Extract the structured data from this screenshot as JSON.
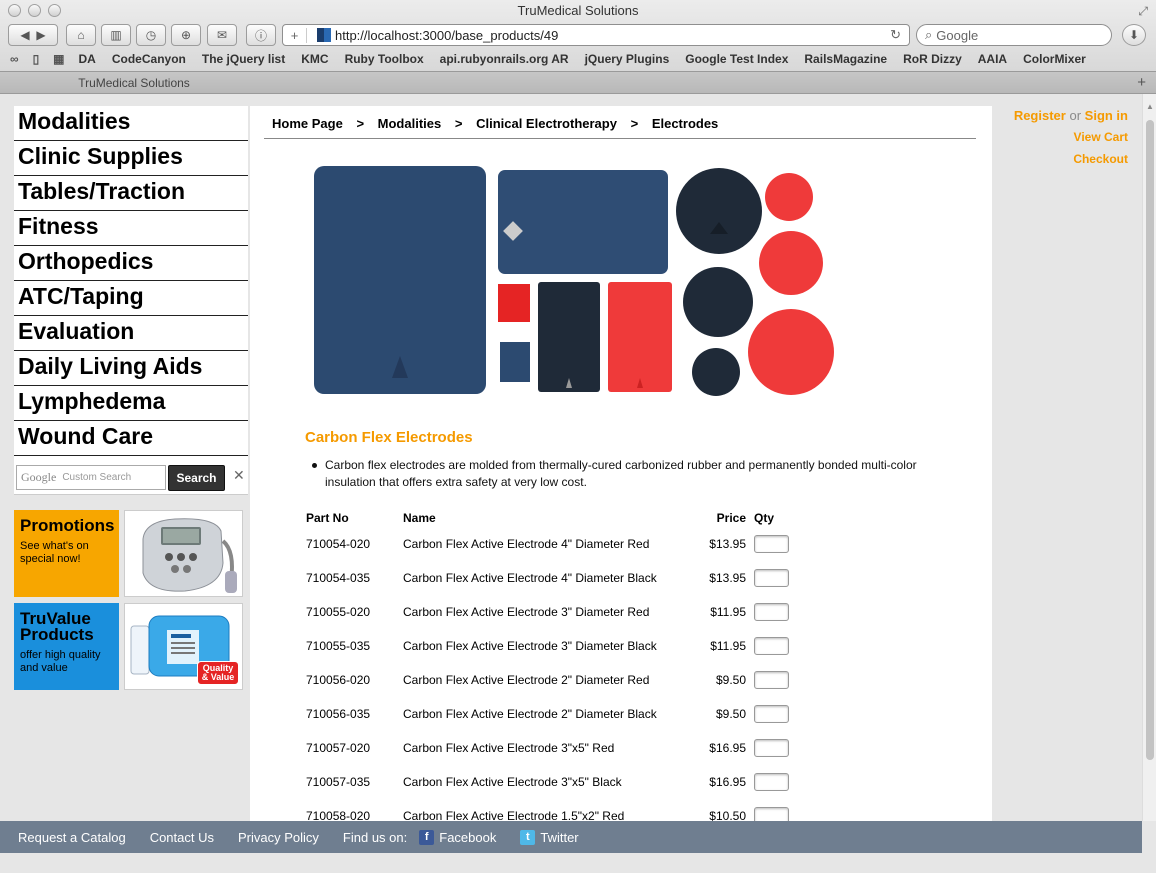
{
  "browser": {
    "title": "TruMedical Solutions",
    "url": "http://localhost:3000/base_products/49",
    "search_placeholder": "Google",
    "bookmarks": [
      "DA",
      "CodeCanyon",
      "The jQuery list",
      "KMC",
      "Ruby Toolbox",
      "api.rubyonrails.org AR",
      "jQuery Plugins",
      "Google Test Index",
      "RailsMagazine",
      "RoR Dizzy",
      "AAIA",
      "ColorMixer"
    ],
    "tab_label": "TruMedical Solutions"
  },
  "sidebar": {
    "nav": [
      "Modalities",
      "Clinic Supplies",
      "Tables/Traction",
      "Fitness",
      "Orthopedics",
      "ATC/Taping",
      "Evaluation",
      "Daily Living Aids",
      "Lymphedema",
      "Wound Care"
    ],
    "search_placeholder": "Custom Search",
    "search_button": "Search",
    "search_brand": "Google",
    "promos": [
      {
        "title": "Promotions",
        "sub": "See what's on special now!",
        "color": "#f7a600"
      },
      {
        "title": "TruValue Products",
        "sub": "offer high quality and value",
        "color": "#1a8fdc",
        "badge": "Quality & Value"
      }
    ]
  },
  "breadcrumb": [
    "Home Page",
    ">",
    "Modalities",
    ">",
    "Clinical Electrotherapy",
    ">",
    "Electrodes"
  ],
  "product": {
    "title": "Carbon Flex Electrodes",
    "description": "Carbon flex electrodes are molded from thermally-cured carbonized rubber and permanently bonded multi-color insulation that offers extra safety at very low cost.",
    "columns": {
      "part": "Part No",
      "name": "Name",
      "price": "Price",
      "qty": "Qty"
    },
    "rows": [
      {
        "part": "710054-020",
        "name": "Carbon Flex Active Electrode 4\" Diameter Red",
        "price": "$13.95"
      },
      {
        "part": "710054-035",
        "name": "Carbon Flex Active Electrode 4\" Diameter Black",
        "price": "$13.95"
      },
      {
        "part": "710055-020",
        "name": "Carbon Flex Active Electrode 3\" Diameter Red",
        "price": "$11.95"
      },
      {
        "part": "710055-035",
        "name": "Carbon Flex Active Electrode 3\" Diameter Black",
        "price": "$11.95"
      },
      {
        "part": "710056-020",
        "name": "Carbon Flex Active Electrode 2\" Diameter Red",
        "price": "$9.50"
      },
      {
        "part": "710056-035",
        "name": "Carbon Flex Active Electrode 2\" Diameter Black",
        "price": "$9.50"
      },
      {
        "part": "710057-020",
        "name": "Carbon Flex Active Electrode 3\"x5\" Red",
        "price": "$16.95"
      },
      {
        "part": "710057-035",
        "name": "Carbon Flex Active Electrode 3\"x5\" Black",
        "price": "$16.95"
      },
      {
        "part": "710058-020",
        "name": "Carbon Flex Active Electrode 1.5\"x2\" Red",
        "price": "$10.50"
      }
    ]
  },
  "account": {
    "register": "Register",
    "or": "or",
    "signin": "Sign in",
    "cart": "View Cart",
    "checkout": "Checkout"
  },
  "footer": {
    "catalog": "Request a Catalog",
    "contact": "Contact Us",
    "privacy": "Privacy Policy",
    "find": "Find us on:",
    "facebook": "Facebook",
    "twitter": "Twitter"
  },
  "colors": {
    "accent": "#f59a00",
    "footer": "#6f7e90",
    "electrode_blue": "#2c4a70",
    "electrode_red": "#ef3a3a",
    "electrode_black": "#1f2a38"
  }
}
